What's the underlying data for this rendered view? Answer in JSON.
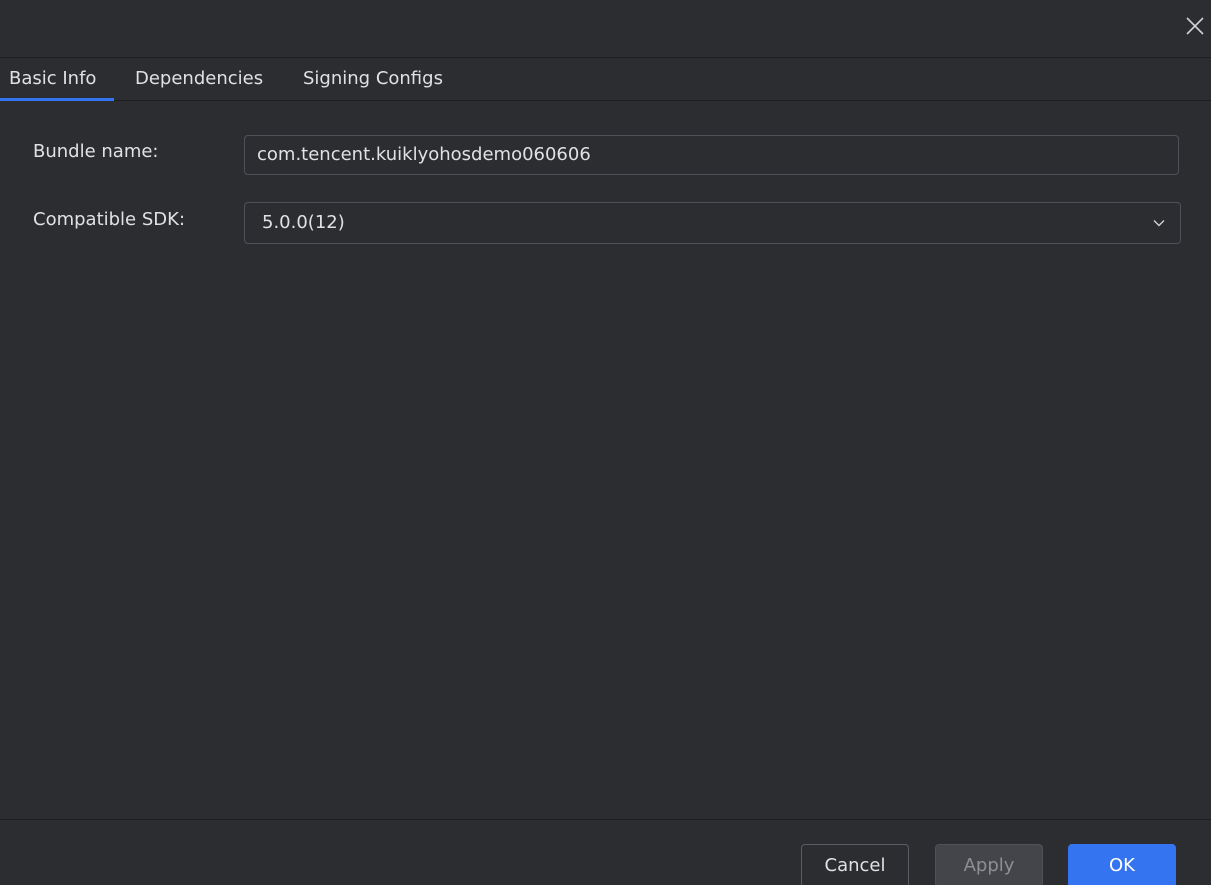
{
  "dialog": {
    "close_icon": "close-icon"
  },
  "tabs": [
    {
      "label": "Basic Info",
      "active": true
    },
    {
      "label": "Dependencies",
      "active": false
    },
    {
      "label": "Signing Configs",
      "active": false
    }
  ],
  "form": {
    "bundle_name": {
      "label": "Bundle name:",
      "value": "com.tencent.kuiklyohosdemo060606"
    },
    "compatible_sdk": {
      "label": "Compatible SDK:",
      "value": "5.0.0(12)",
      "icon": "chevron-down-icon"
    }
  },
  "footer": {
    "cancel_label": "Cancel",
    "apply_label": "Apply",
    "ok_label": "OK"
  },
  "colors": {
    "background": "#2b2d30",
    "accent": "#3574f0",
    "text": "#dfe1e5",
    "border": "#4e5157"
  }
}
